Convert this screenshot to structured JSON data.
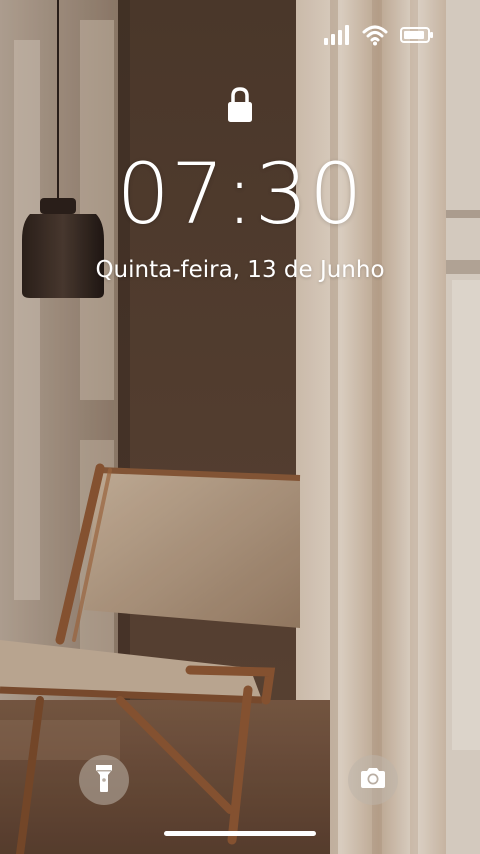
{
  "lock_screen": {
    "time": "07:30",
    "date": "Quinta-feira, 13 de Junho"
  },
  "status_bar": {
    "icons": [
      "cellular-signal-icon",
      "wifi-icon",
      "battery-icon"
    ]
  },
  "quick_actions": {
    "left_icon": "flashlight-icon",
    "right_icon": "camera-icon"
  },
  "colors": {
    "text": "#ffffff",
    "button_bg": "#beb4aa"
  }
}
